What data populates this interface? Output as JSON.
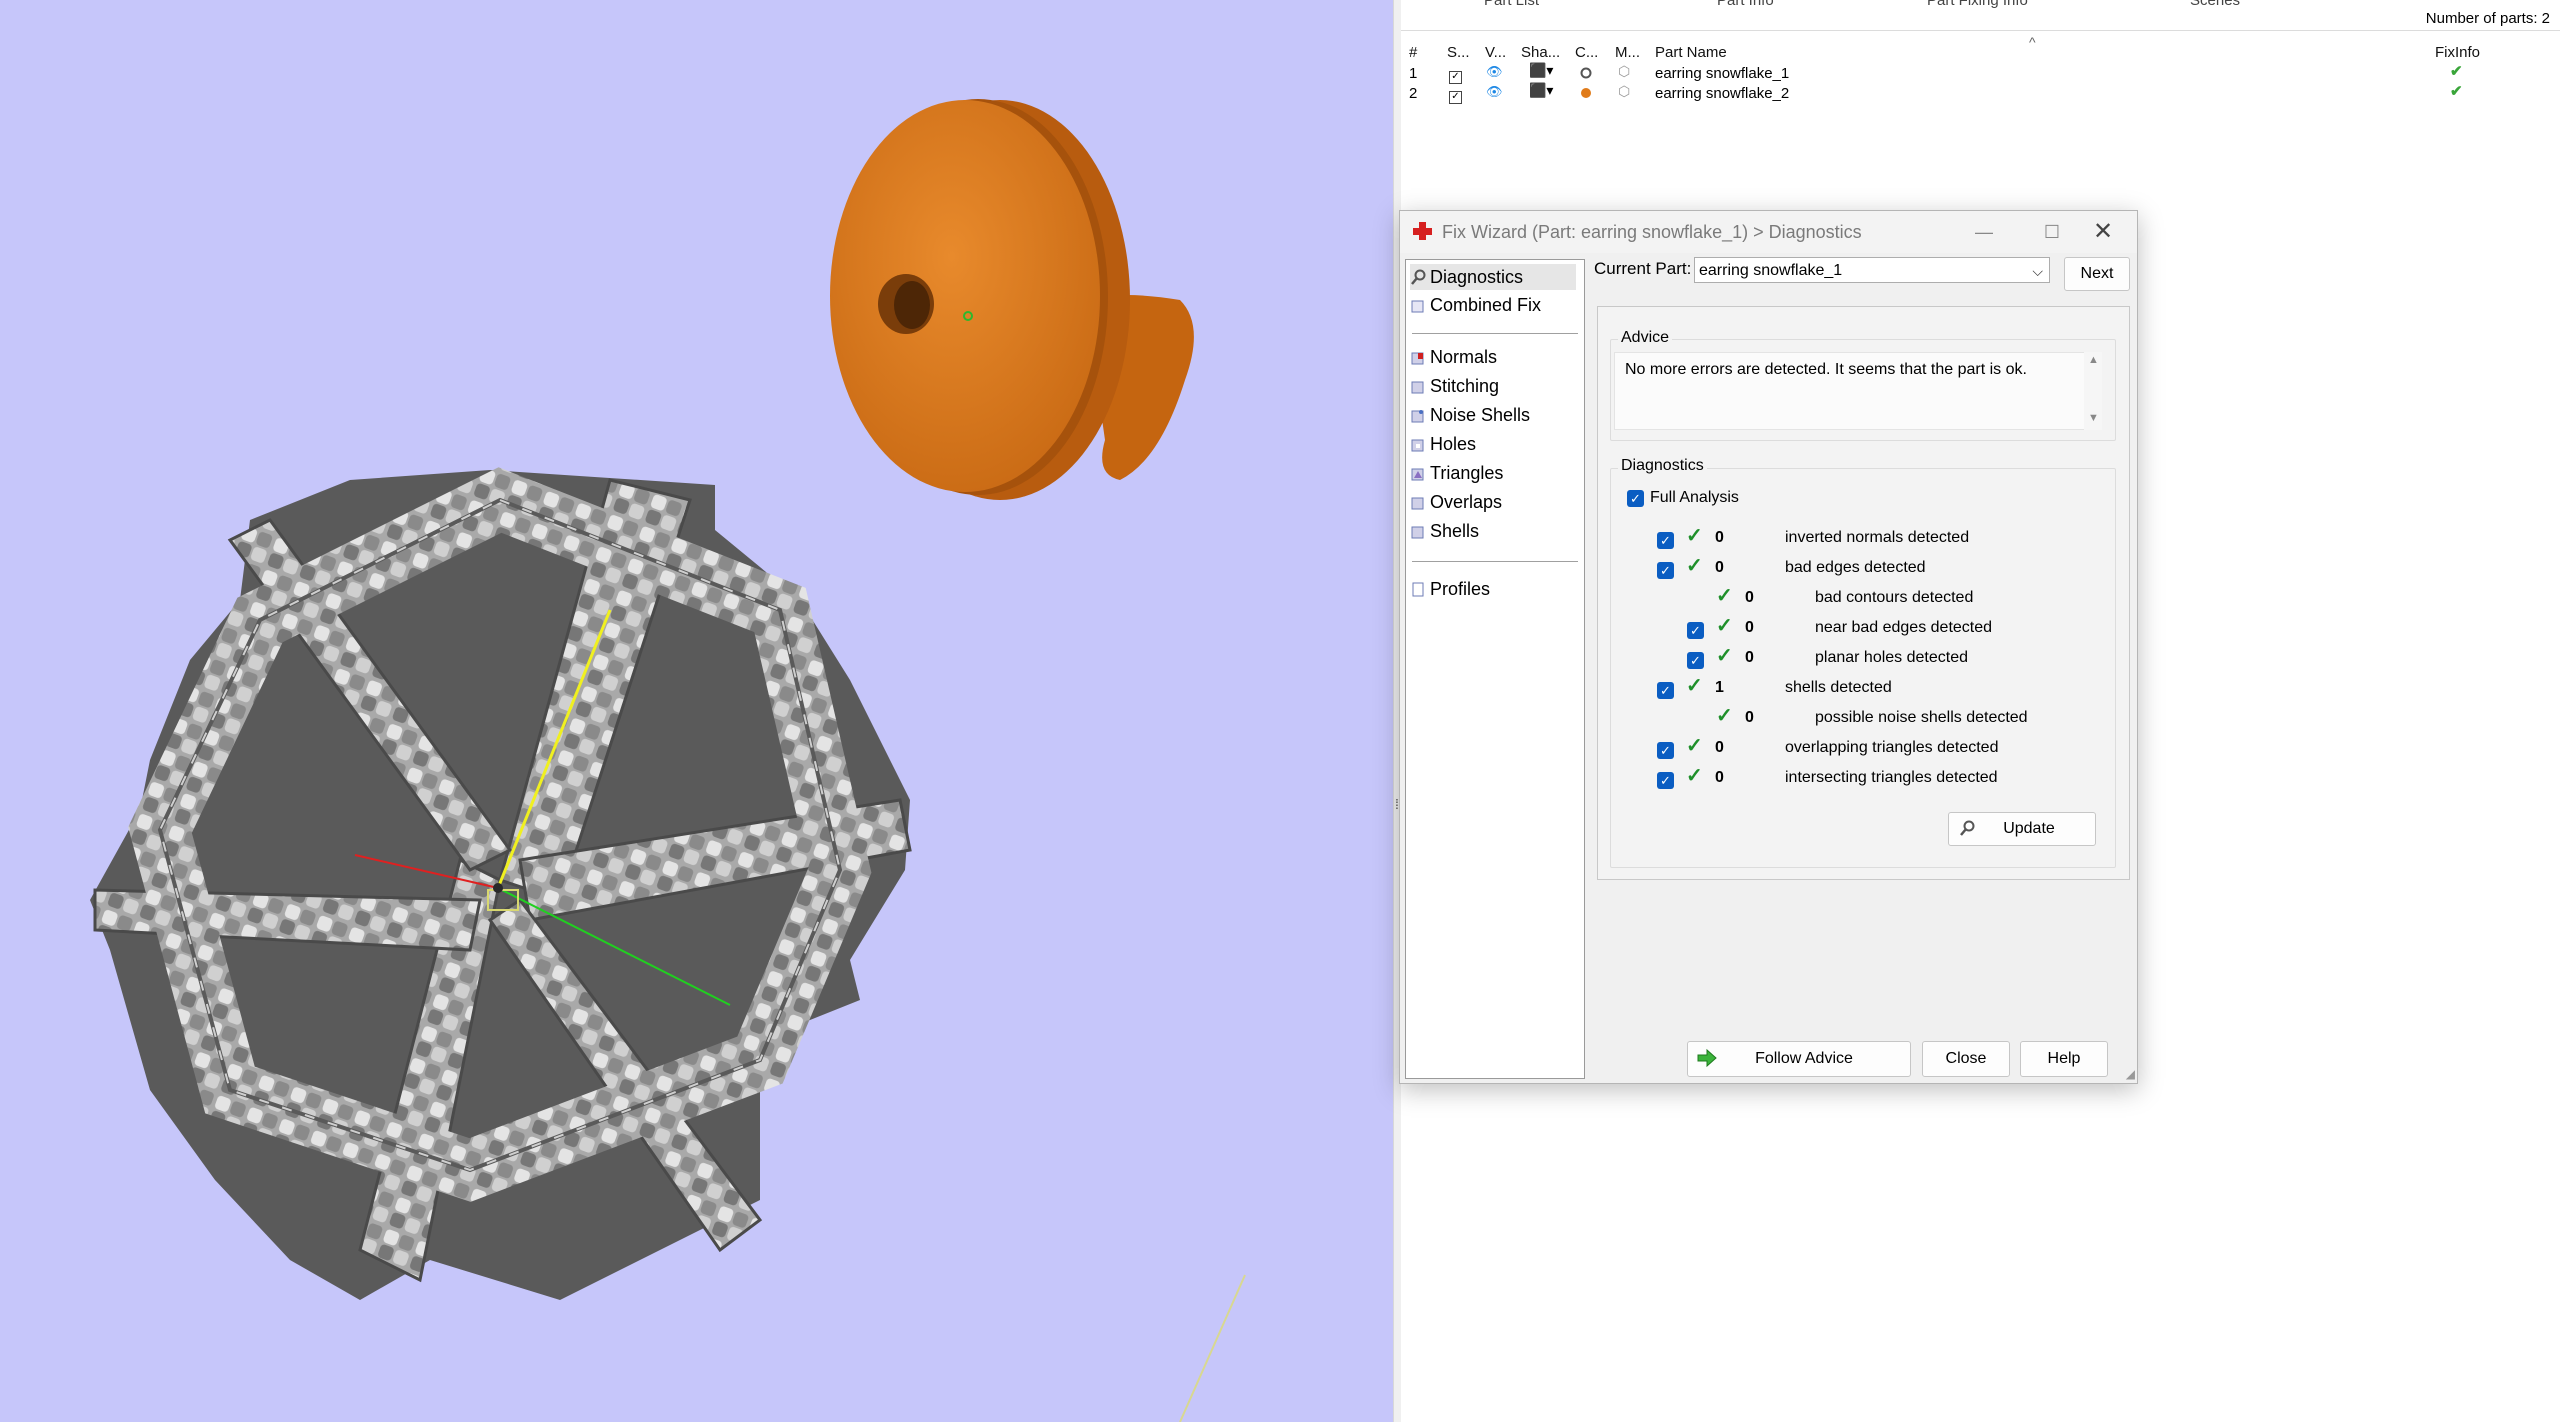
{
  "right_panel": {
    "tabs": [
      "Part List",
      "Part Info",
      "Part Fixing Info",
      "Scenes"
    ],
    "number_of_parts": "Number of parts: 2",
    "columns": [
      "#",
      "S...",
      "V...",
      "Sha...",
      "C...",
      "M...",
      "Part Name",
      "FixInfo"
    ],
    "parts": [
      {
        "num": "1",
        "name": "earring snowflake_1",
        "color": "#555555",
        "fixinfo": "✔"
      },
      {
        "num": "2",
        "name": "earring snowflake_2",
        "color": "#e07b1a",
        "fixinfo": "✔"
      }
    ]
  },
  "dialog": {
    "title": "Fix Wizard (Part: earring snowflake_1) > Diagnostics",
    "nav": {
      "group1": [
        "Diagnostics",
        "Combined Fix"
      ],
      "group2": [
        "Normals",
        "Stitching",
        "Noise Shells",
        "Holes",
        "Triangles",
        "Overlaps",
        "Shells"
      ],
      "group3": [
        "Profiles"
      ]
    },
    "current_part_label": "Current Part:",
    "current_part_value": "earring snowflake_1",
    "next_label": "Next",
    "advice": {
      "title": "Advice",
      "text": "No more errors are detected. It seems that the part is ok."
    },
    "diagnostics": {
      "title": "Diagnostics",
      "full_analysis": "Full Analysis",
      "rows": [
        {
          "value": "0",
          "label": "inverted normals detected"
        },
        {
          "value": "0",
          "label": "bad edges detected"
        },
        {
          "value": "0",
          "label": "bad contours detected"
        },
        {
          "value": "0",
          "label": "near bad edges detected"
        },
        {
          "value": "0",
          "label": "planar holes detected"
        },
        {
          "value": "1",
          "label": "shells detected"
        },
        {
          "value": "0",
          "label": "possible noise shells detected"
        },
        {
          "value": "0",
          "label": "overlapping triangles detected"
        },
        {
          "value": "0",
          "label": "intersecting triangles detected"
        }
      ],
      "update_label": "Update"
    },
    "buttons": {
      "follow_advice": "Follow Advice",
      "close": "Close",
      "help": "Help"
    }
  },
  "colors": {
    "viewport_bg": "#c6c6fa",
    "accent_blue": "#0a5dc2",
    "check_green": "#1f8f2a",
    "part_orange": "#d97a22",
    "part_gray": "#9a9a9a"
  }
}
